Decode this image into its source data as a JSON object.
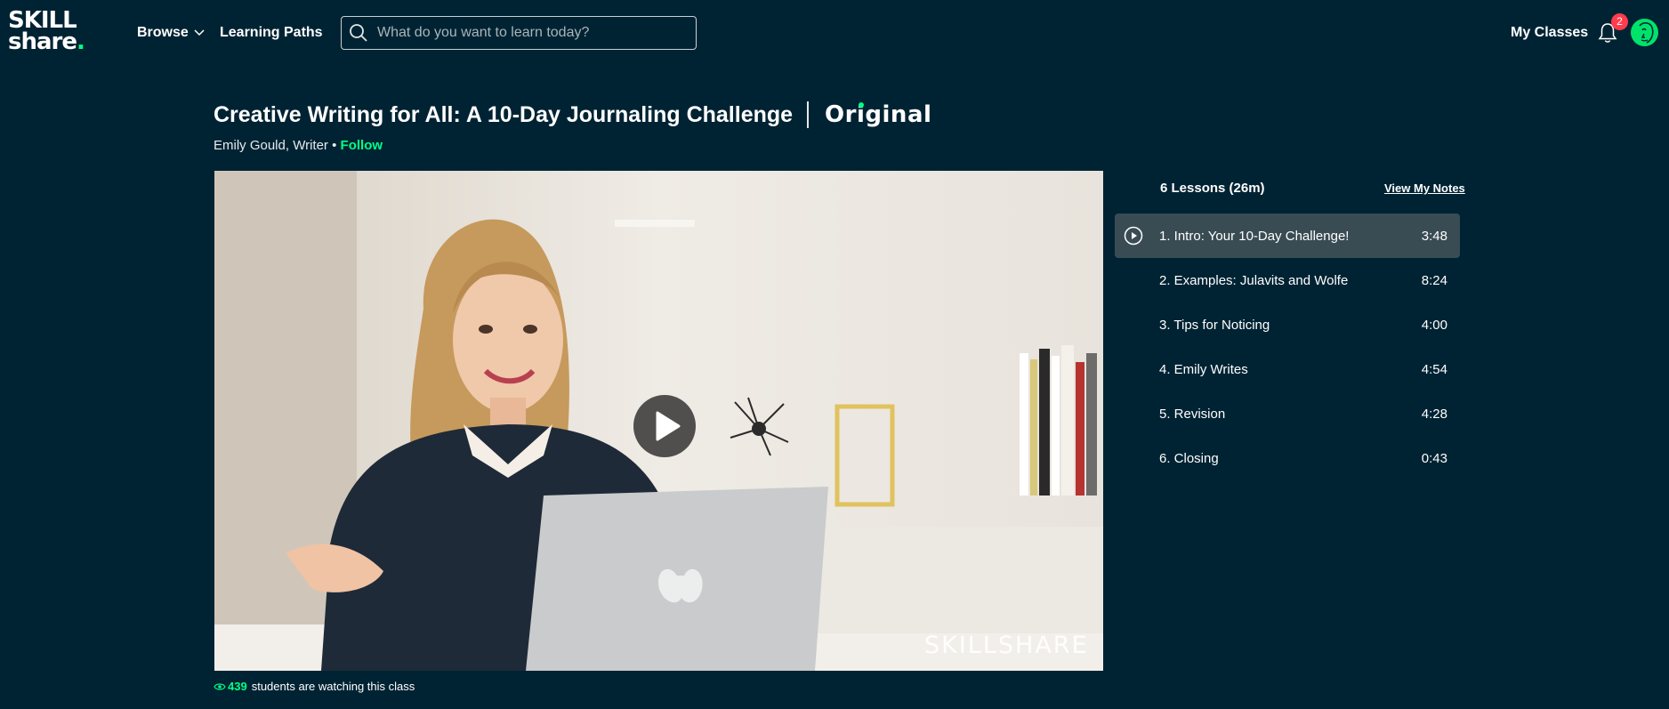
{
  "brand": {
    "line1": "SKILL",
    "line2": "share",
    "dot": "."
  },
  "nav": {
    "browse": "Browse",
    "learning_paths": "Learning Paths"
  },
  "search": {
    "placeholder": "What do you want to learn today?"
  },
  "header_right": {
    "my_classes": "My Classes",
    "notification_count": "2"
  },
  "class": {
    "title": "Creative Writing for All: A 10-Day Journaling Challenge",
    "badge": "Original",
    "instructor": "Emily Gould, Writer",
    "separator": "•",
    "follow": "Follow"
  },
  "video": {
    "watermark": "SKILLSHARE"
  },
  "watchers": {
    "count": "439",
    "text": "students are watching this class"
  },
  "lessons": {
    "heading": "6 Lessons (26m)",
    "notes_link": "View My Notes",
    "items": [
      {
        "title": "1. Intro: Your 10-Day Challenge!",
        "duration": "3:48",
        "active": true
      },
      {
        "title": "2. Examples: Julavits and Wolfe",
        "duration": "8:24"
      },
      {
        "title": "3. Tips for Noticing",
        "duration": "4:00"
      },
      {
        "title": "4. Emily Writes",
        "duration": "4:54"
      },
      {
        "title": "5. Revision",
        "duration": "4:28"
      },
      {
        "title": "6. Closing",
        "duration": "0:43"
      }
    ]
  },
  "colors": {
    "background": "#002333",
    "accent": "#00ff84",
    "badge": "#ff3b4c",
    "active_row": "#394c54"
  }
}
